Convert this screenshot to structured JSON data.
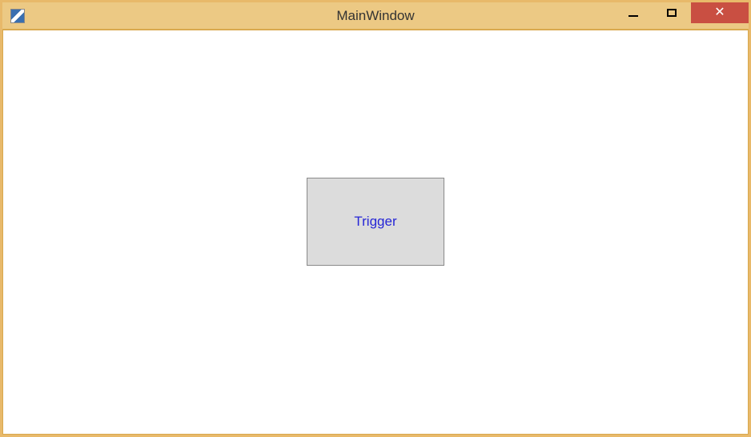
{
  "window": {
    "title": "MainWindow",
    "controls": {
      "minimize": "Minimize",
      "maximize": "Maximize",
      "close": "Close"
    }
  },
  "content": {
    "trigger_button_label": "Trigger"
  },
  "colors": {
    "frame": "#e8b96a",
    "titlebar": "#ecc984",
    "client": "#ffffff",
    "close_btn": "#c94f42",
    "button_face": "#dcdcdc",
    "button_text": "#2626d6"
  }
}
